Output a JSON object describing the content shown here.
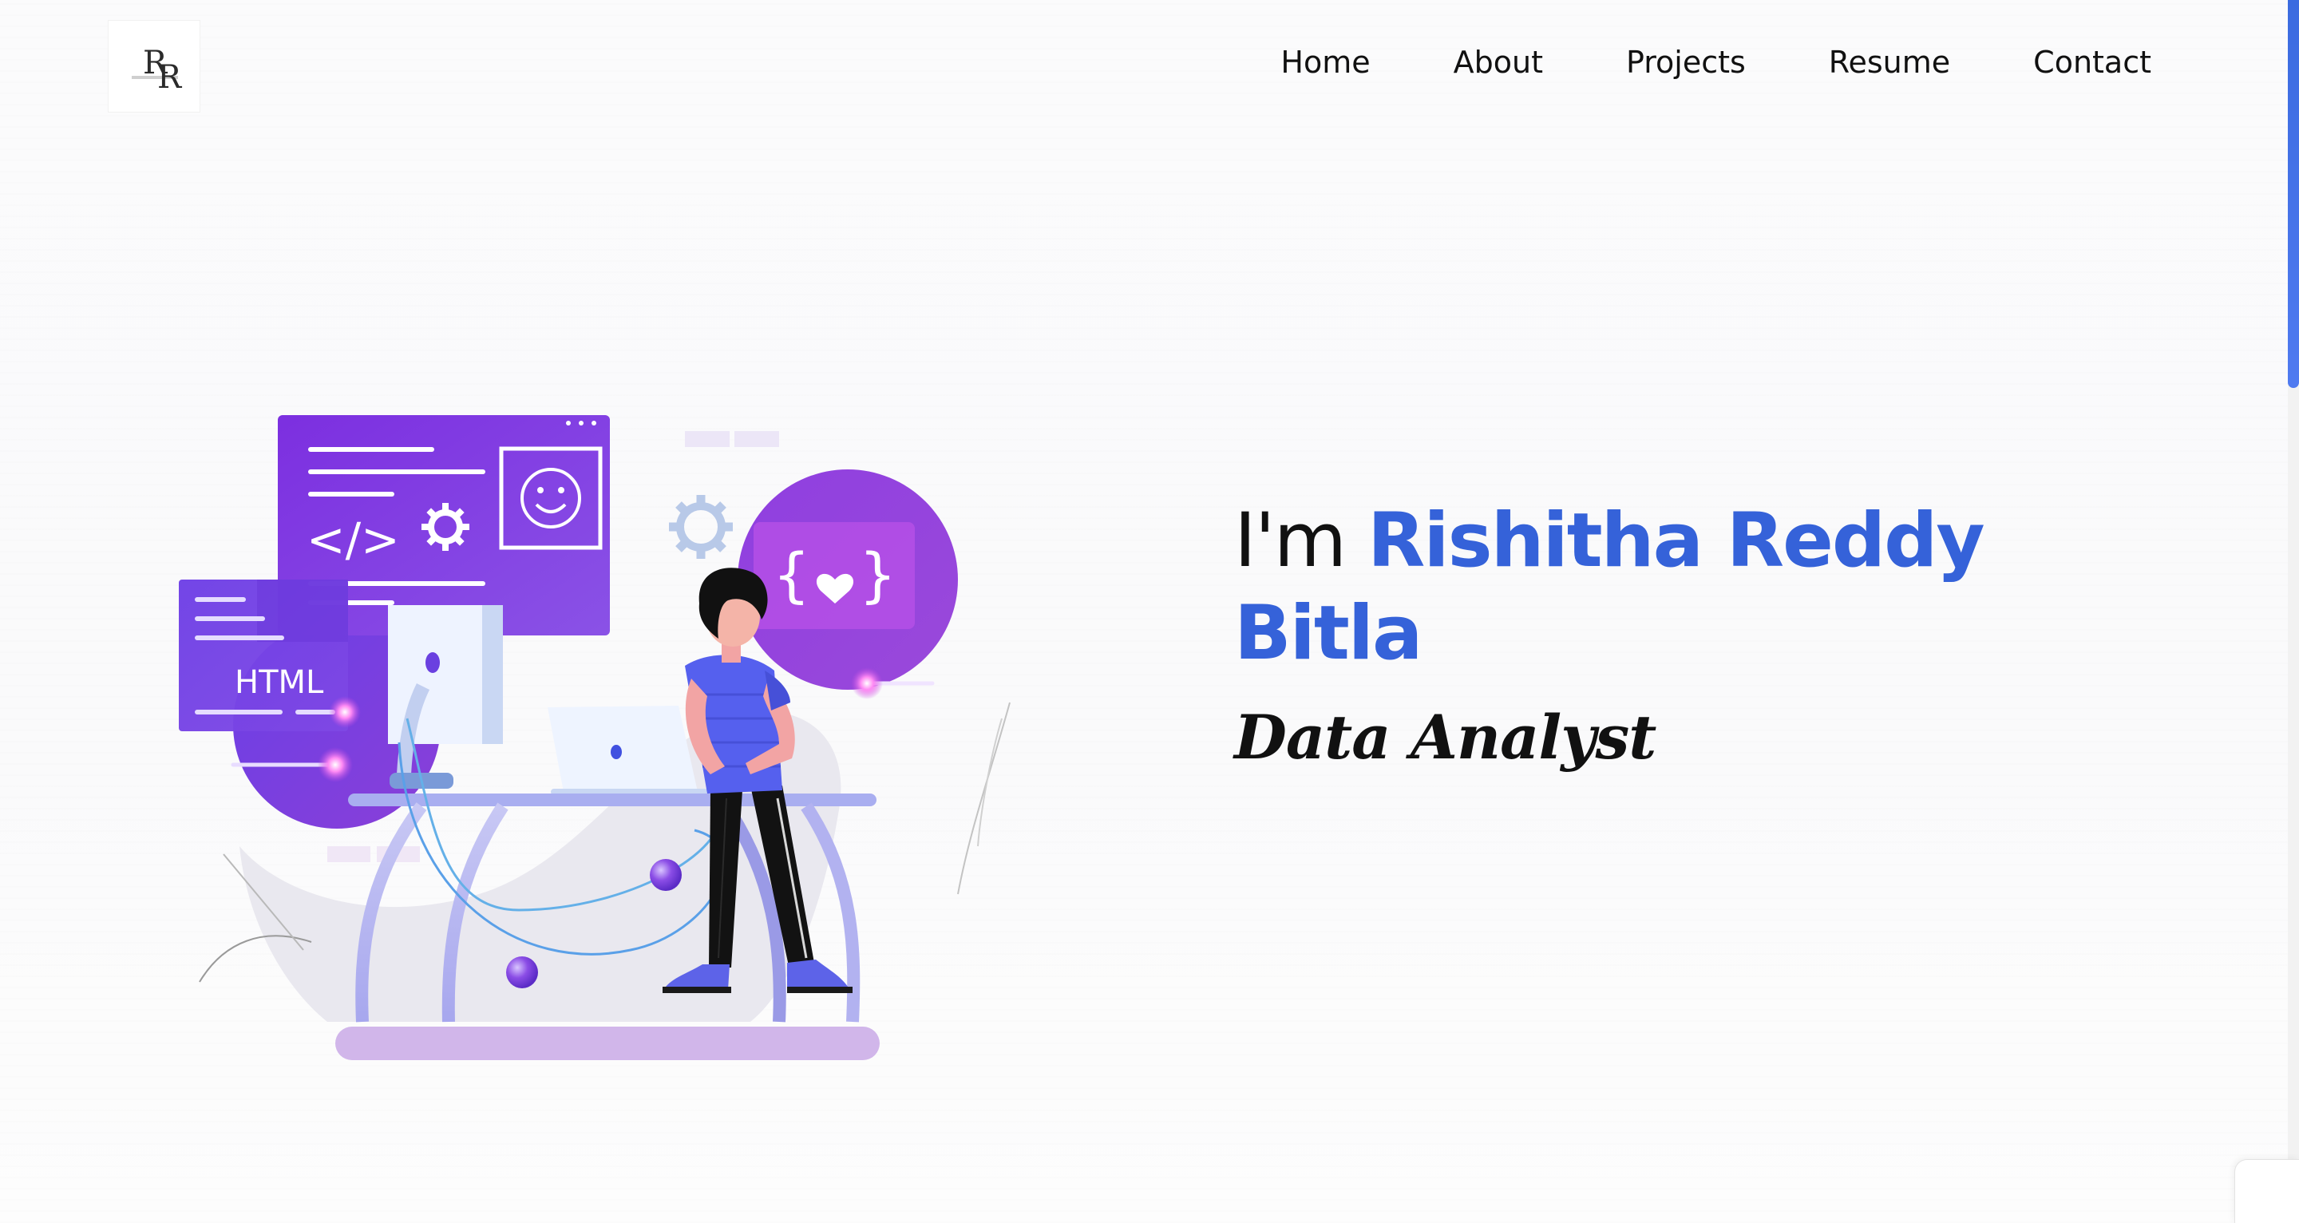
{
  "header": {
    "logo_text_primary": "R",
    "logo_text_secondary": "R",
    "nav_items": [
      {
        "label": "Home"
      },
      {
        "label": "About"
      },
      {
        "label": "Projects"
      },
      {
        "label": "Resume"
      },
      {
        "label": "Contact"
      }
    ]
  },
  "hero": {
    "greeting": "I'm ",
    "name": "Rishitha Reddy Bitla",
    "role": "Data Analyst",
    "illustration": {
      "html_label": "HTML",
      "code_symbol": "</>",
      "braces_left": "{",
      "braces_right": "}"
    }
  },
  "theme": {
    "accent": "#3562d9",
    "illustration_purple": "#7a3fe0",
    "scrollbar": "#3b6be0"
  },
  "icons": [
    "logo-monogram",
    "gear-icon",
    "smiley-icon",
    "heart-icon",
    "code-icon"
  ]
}
